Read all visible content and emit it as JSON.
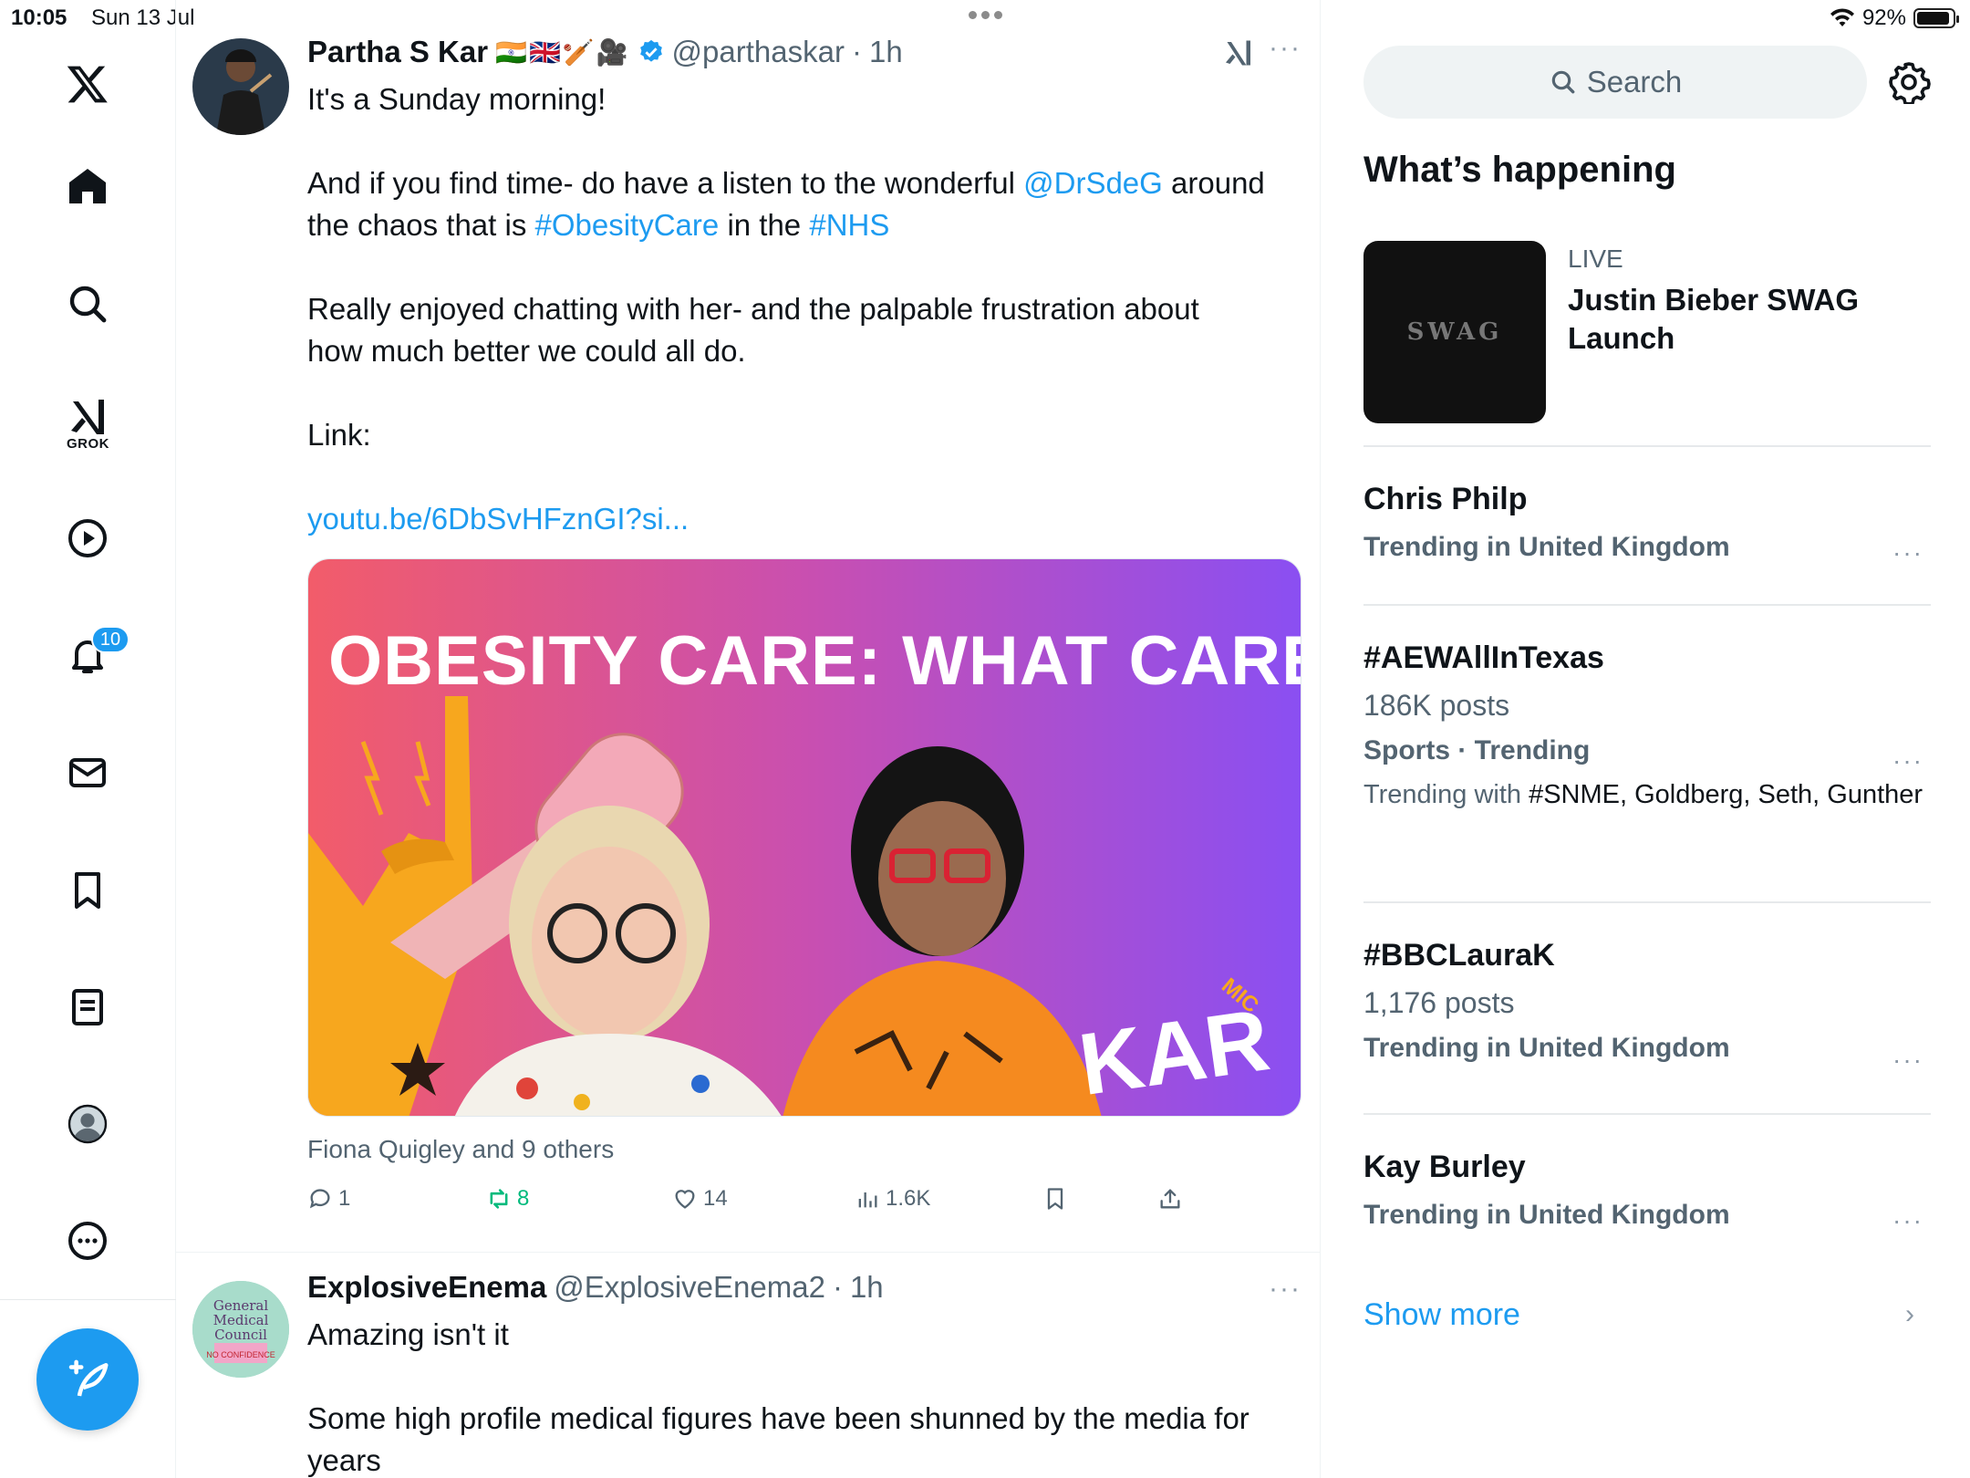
{
  "status": {
    "time": "10:05",
    "date": "Sun 13 Jul",
    "battery": "92%",
    "battery_level": 0.92
  },
  "nav": {
    "grok_label": "GROK",
    "notifications_badge": "10"
  },
  "tweets": [
    {
      "name": "Partha S Kar",
      "flags": "🇮🇳🇬🇧🏏🎥",
      "handle": "@parthaskar",
      "dot": "·",
      "time": "1h",
      "more": "···",
      "lines": [
        "It's a Sunday morning!",
        "",
        "And if you find time- do have a listen to the wonderful",
        "@DrSdeG",
        "around",
        "the chaos that is",
        "#ObesityCare",
        "in the",
        "#NHS",
        "Really enjoyed chatting with her- and the palpable frustration about",
        "how much better we could all do.",
        "Link:",
        "youtu.be/6DbSvHFznGI?si..."
      ],
      "media_title": "OBESITY CARE: WHAT CARE?",
      "media_brand": "KAR",
      "media_brand_small": "MIC",
      "liked_by": "Fiona Quigley and 9 others",
      "replies": "1",
      "reposts": "8",
      "likes": "14",
      "views": "1.6K"
    },
    {
      "name": "ExplosiveEnema",
      "handle": "@ExplosiveEnema2",
      "dot": "·",
      "time": "1h",
      "more": "···",
      "avatar_text_1": "General",
      "avatar_text_2": "Medical",
      "avatar_text_3": "Council",
      "avatar_text_4": "NO CONFIDENCE",
      "line1": "Amazing isn't it",
      "line2": "Some high profile medical figures have been shunned by the media for",
      "line3": "years"
    }
  ],
  "sidebar": {
    "search_placeholder": "Search",
    "title": "What’s happening",
    "live": {
      "tag": "LIVE",
      "title": "Justin Bieber SWAG Launch",
      "thumb_text": "SWAG"
    },
    "trends": [
      {
        "name": "Chris Philp",
        "sub": "Trending in United Kingdom"
      },
      {
        "name": "#AEWAllInTexas",
        "count": "186K posts",
        "sub": "Sports · Trending",
        "with_prefix": "Trending with",
        "with_items": "#SNME, Goldberg, Seth, Gunther"
      },
      {
        "name": "#BBCLauraK",
        "count": "1,176 posts",
        "sub": "Trending in United Kingdom"
      },
      {
        "name": "Kay Burley",
        "sub": "Trending in United Kingdom"
      }
    ],
    "show_more": "Show more",
    "more_glyph": "···",
    "chevron": "›"
  },
  "colors": {
    "accent": "#1d9bf0",
    "repost": "#00ba7c",
    "muted": "#536471"
  }
}
